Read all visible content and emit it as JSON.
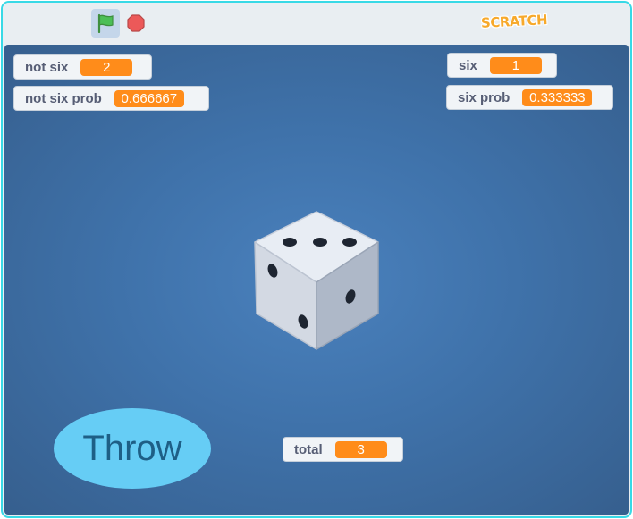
{
  "toolbar": {
    "green_flag_icon": "green-flag-icon",
    "stop_icon": "stop-sign-icon",
    "logo_text": "SCRATCH"
  },
  "monitors": {
    "not_six": {
      "label": "not six",
      "value": "2"
    },
    "not_six_prob": {
      "label": "not six prob",
      "value": "0.666667"
    },
    "six": {
      "label": "six",
      "value": "1"
    },
    "six_prob": {
      "label": "six prob",
      "value": "0.333333"
    },
    "total": {
      "label": "total",
      "value": "3"
    }
  },
  "stage": {
    "throw_button_label": "Throw",
    "dice_sprite": "dice-icon"
  },
  "colors": {
    "accent_border": "#38d9e6",
    "monitor_value_bg": "#ff8c1a",
    "throw_button_bg": "#66cdf5",
    "stage_bg": "#4a81bd"
  }
}
